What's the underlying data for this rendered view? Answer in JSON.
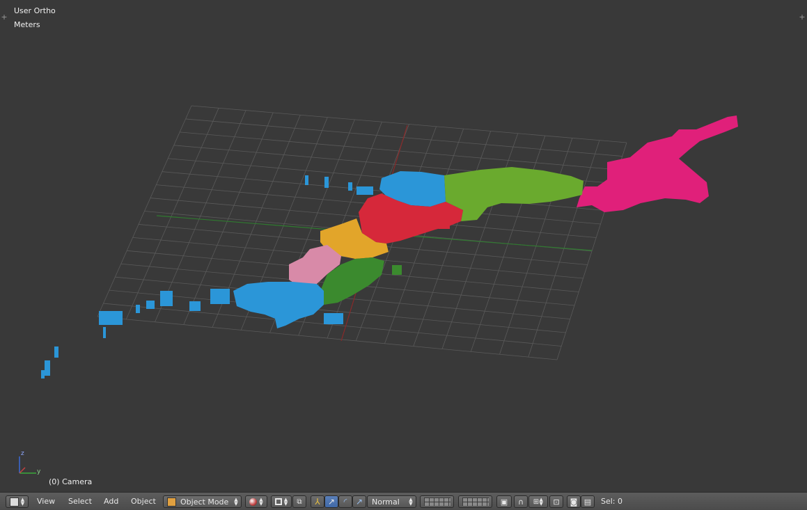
{
  "viewport": {
    "view_name": "User Ortho",
    "units": "Meters",
    "object_info": "(0) Camera",
    "axis_labels": {
      "z": "z",
      "y": "y"
    },
    "colors": {
      "background": "#393939",
      "grid": "#5a5a5a",
      "x_axis": "#8a2a2a",
      "y_axis": "#2f7a2f",
      "region_blue": "#2b96d8",
      "region_green": "#6aaa2e",
      "region_red": "#d6283a",
      "region_orange": "#e2a52a",
      "region_pink": "#d88aa8",
      "region_darkgreen": "#3b8a2e",
      "region_magenta": "#e0207a"
    }
  },
  "header": {
    "menus": {
      "view": "View",
      "select": "Select",
      "add": "Add",
      "object": "Object"
    },
    "mode": "Object Mode",
    "pivot_mode": "Normal",
    "status": "Sel: 0",
    "icons": {
      "editor_type": "cube-editor-icon",
      "shading": "shading-sphere-icon",
      "pivot": "pivot-point-icon",
      "manipulator": "manipulator-icon",
      "translate": "translate-arrow-icon",
      "rotate": "rotate-arc-icon",
      "scale": "scale-arrow-icon",
      "layers": "layers-grid-icon",
      "lock": "lock-camera-icon",
      "snap": "snap-magnet-icon",
      "snap_target": "snap-target-icon",
      "render": "render-camera-icon",
      "clapper": "clapperboard-icon"
    }
  }
}
